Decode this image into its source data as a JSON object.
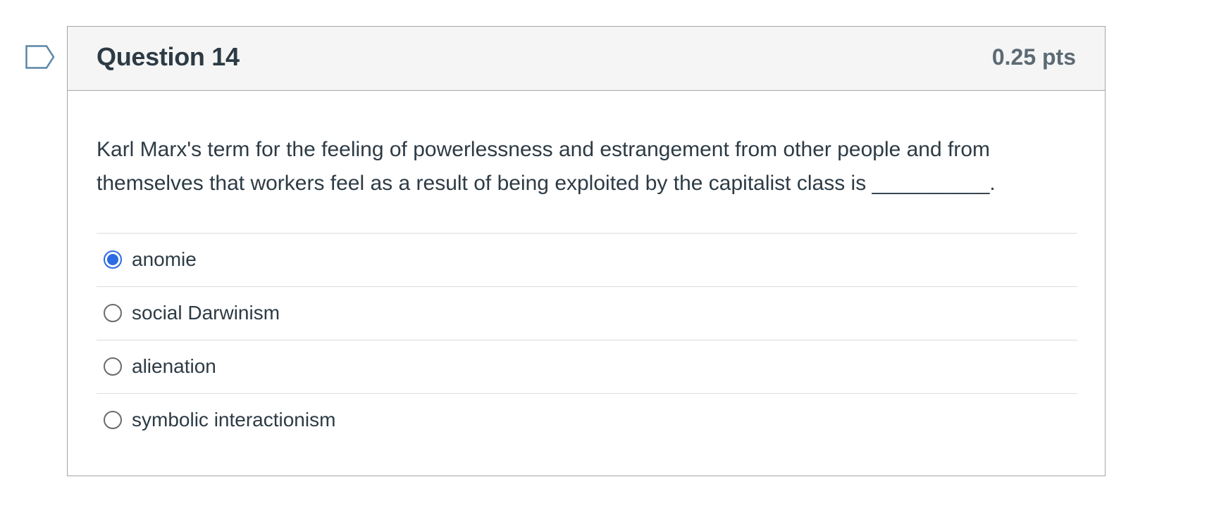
{
  "question": {
    "title": "Question 14",
    "points": "0.25 pts",
    "text": "Karl Marx's term for the feeling of powerlessness and estrangement from other people and from themselves that workers feel as a result of being exploited by the capitalist class is __________.",
    "flag_icon": "flag-icon",
    "answers": [
      {
        "label": "anomie",
        "selected": true
      },
      {
        "label": "social Darwinism",
        "selected": false
      },
      {
        "label": "alienation",
        "selected": false
      },
      {
        "label": "symbolic interactionism",
        "selected": false
      }
    ]
  },
  "colors": {
    "accent": "#2d6be3",
    "header_bg": "#f5f5f5",
    "border": "#a6a6a6",
    "flag": "#5b86a8"
  }
}
